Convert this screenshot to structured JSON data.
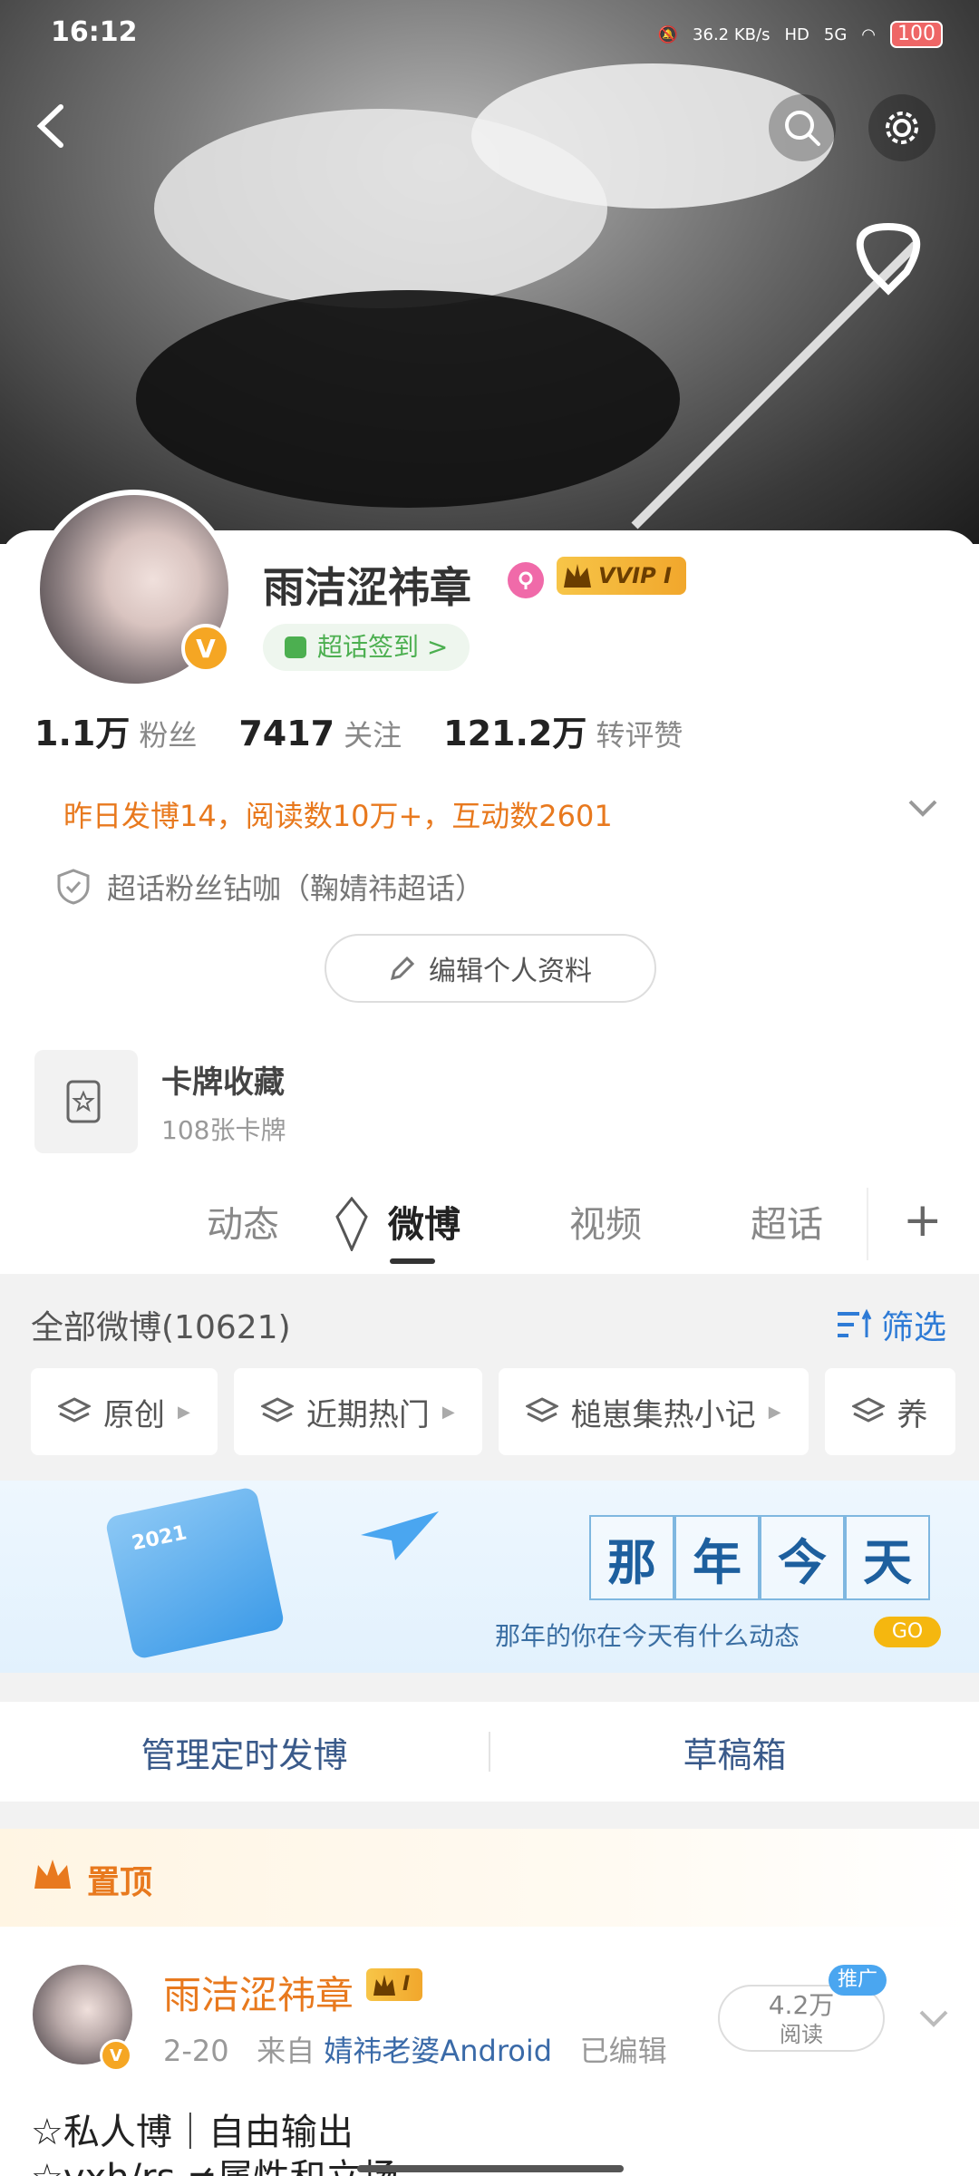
{
  "status_bar": {
    "time": "16:12",
    "net_speed": "36.2",
    "net_unit": "KB/s",
    "hd": "HD",
    "signal": "5G",
    "battery": "100"
  },
  "profile": {
    "username": "雨洁涩祎章",
    "vvip_label": "VVIP I",
    "chaohua_checkin": "超话签到 >",
    "stats": [
      {
        "num": "1.1万",
        "label": "粉丝"
      },
      {
        "num": "7417",
        "label": "关注"
      },
      {
        "num": "121.2万",
        "label": "转评赞"
      }
    ],
    "daily_summary": "昨日发博14，阅读数10万+，互动数2601",
    "super_topic_role": "超话粉丝钻咖（鞠婧祎超话）",
    "edit_profile": "编辑个人资料"
  },
  "card_collection": {
    "title": "卡牌收藏",
    "subtitle": "108张卡牌"
  },
  "tabs": [
    "动态",
    "微博",
    "视频",
    "超话"
  ],
  "feed": {
    "all_weibo": "全部微博(10621)",
    "filter": "筛选",
    "chips": [
      "原创",
      "近期热门",
      "槌崽集热小记",
      "养"
    ],
    "memory": {
      "calendar_year": "2021",
      "title_chars": [
        "那",
        "年",
        "今",
        "天"
      ],
      "subtitle": "那年的你在今天有什么动态",
      "go": "GO"
    },
    "manage": {
      "scheduled": "管理定时发博",
      "drafts": "草稿箱"
    },
    "pinned": {
      "label": "置顶",
      "author": "雨洁涩祎章",
      "level": "I",
      "date": "2-20",
      "from_prefix": "来自",
      "source": "婧祎老婆Android",
      "edited": "已编辑",
      "read_count": "4.2万",
      "read_label": "阅读",
      "promo": "推广",
      "text_line1": "☆私人博｜自由输出",
      "text_line2": "☆yxh/rs ≠属性和立场"
    }
  },
  "colors": {
    "accent_orange": "#e8791e",
    "link_blue": "#2e7bd6",
    "vip_gold": "#f5a623",
    "green": "#4caf50"
  }
}
